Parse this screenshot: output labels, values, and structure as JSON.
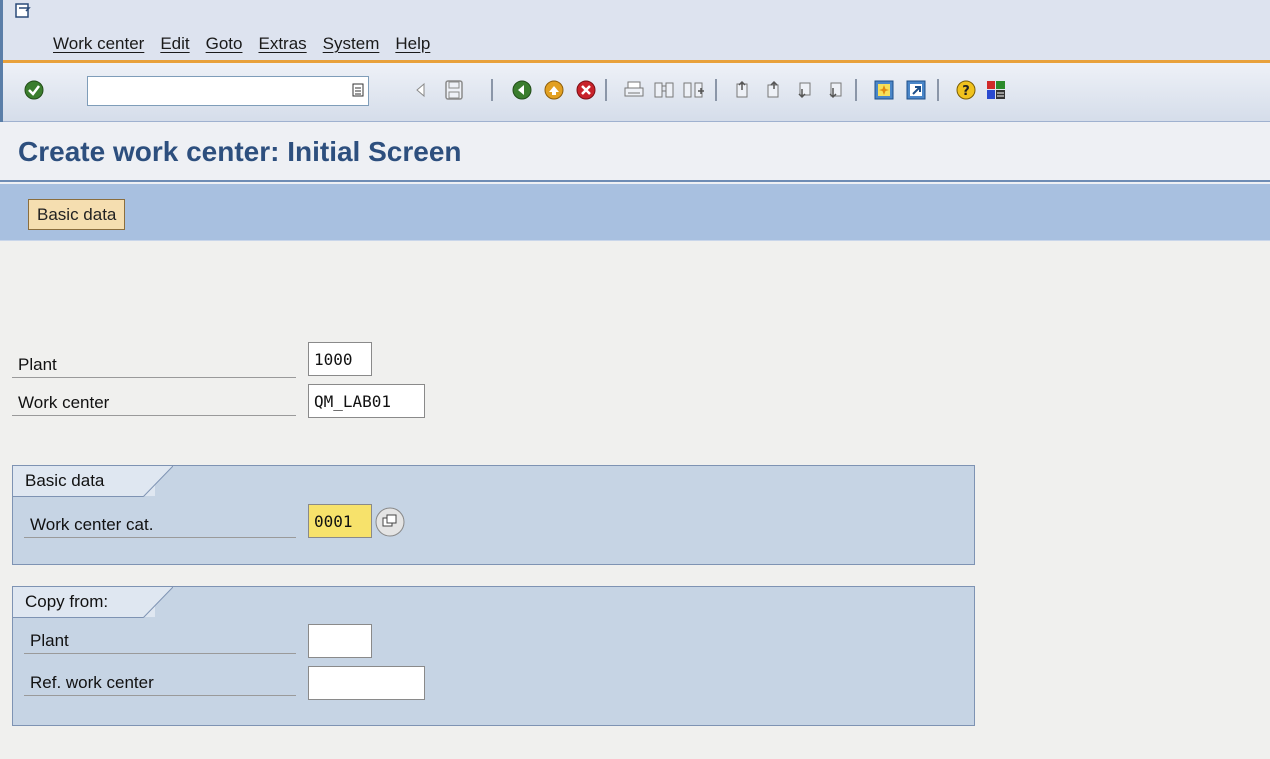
{
  "menu": {
    "items": [
      "Work center",
      "Edit",
      "Goto",
      "Extras",
      "System",
      "Help"
    ]
  },
  "toolbar": {
    "command_value": "",
    "icons": [
      "enter-icon",
      "command-field-dropdown-icon",
      "back-arrow-icon",
      "save-icon",
      "back-icon",
      "exit-icon",
      "cancel-icon",
      "print-icon",
      "find-icon",
      "find-next-icon",
      "first-page-icon",
      "previous-page-icon",
      "next-page-icon",
      "last-page-icon",
      "create-session-icon",
      "shortcut-icon",
      "help-icon",
      "layout-icon"
    ]
  },
  "page": {
    "title": "Create work center: Initial Screen"
  },
  "appbar": {
    "basic_data_button": "Basic data"
  },
  "header_fields": {
    "plant_label": "Plant",
    "plant_value": "1000",
    "work_center_label": "Work center",
    "work_center_value": "QM_LAB01"
  },
  "basic_data_group": {
    "title": "Basic data",
    "category_label": "Work center cat.",
    "category_value": "0001"
  },
  "copy_from_group": {
    "title": "Copy from:",
    "plant_label": "Plant",
    "plant_value": "",
    "ref_label": "Ref. work center",
    "ref_value": ""
  },
  "colors": {
    "title": "#2d4f7e",
    "appbar": "#a8c0e0",
    "accent_line": "#e8a13c",
    "highlight_field": "#f7e26b"
  }
}
